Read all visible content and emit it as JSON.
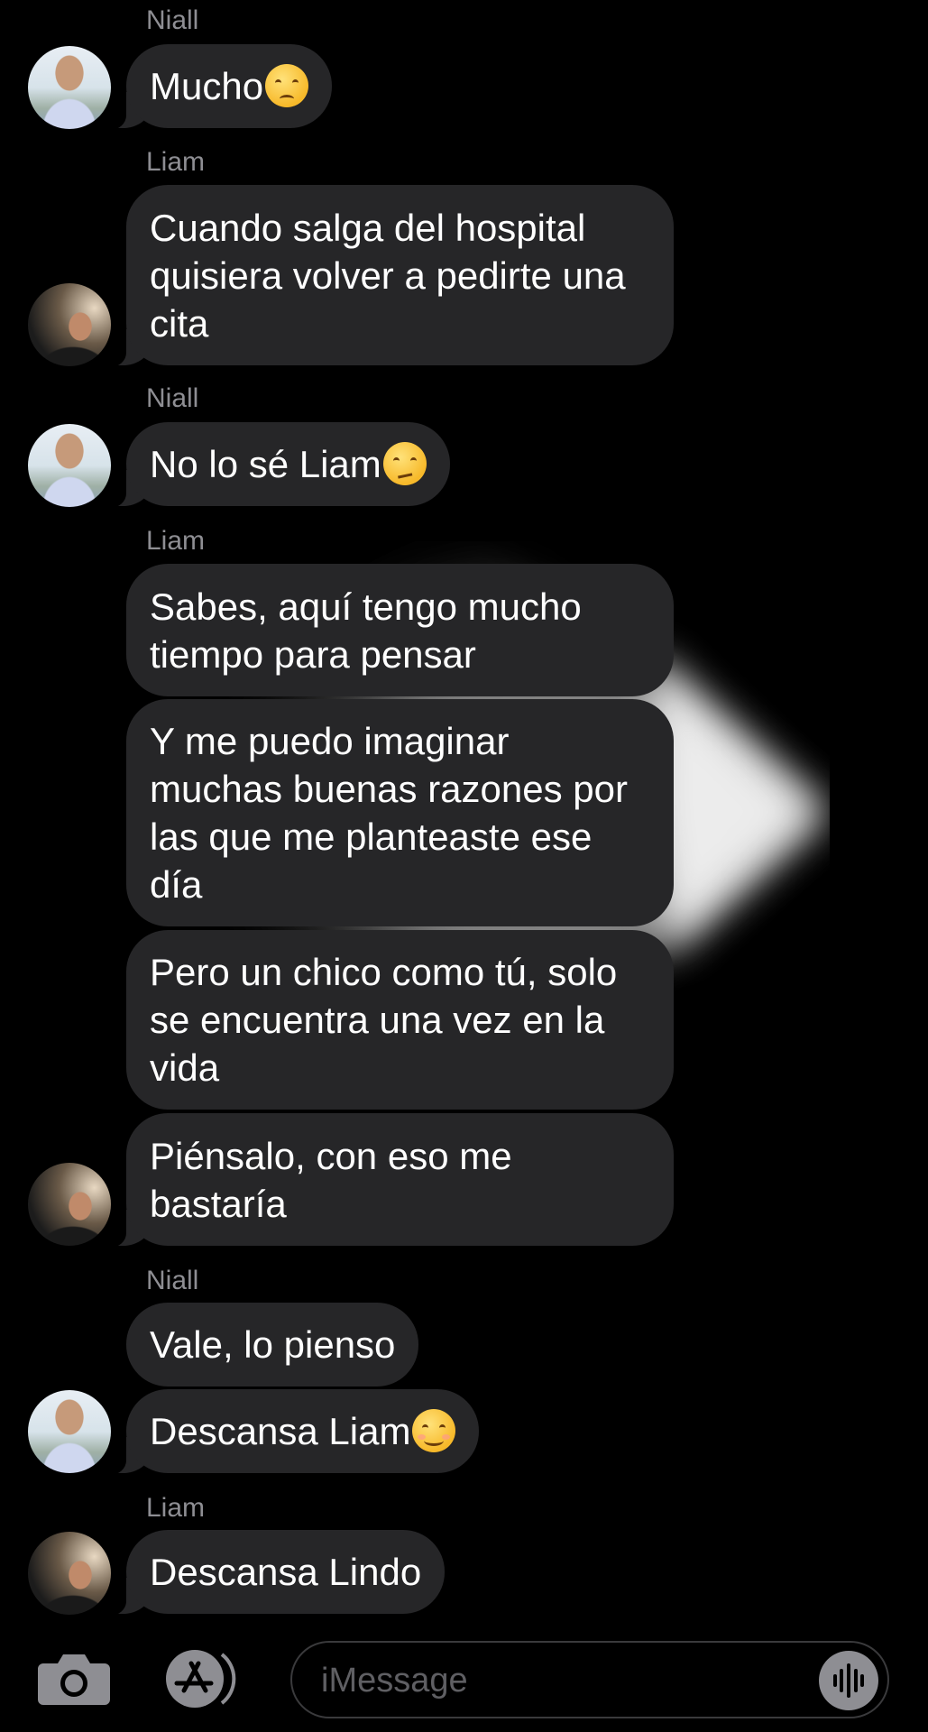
{
  "messages": [
    {
      "sender": "Niall",
      "text": "Mucho",
      "emoji": "pensive-face"
    },
    {
      "sender": "Liam",
      "lines": [
        "Cuando salga del hospital",
        "quisiera volver a pedirte una",
        "cita"
      ]
    },
    {
      "sender": "Niall",
      "text": "No lo sé Liam",
      "emoji": "confused-face"
    },
    {
      "sender": "Liam",
      "lines": [
        "Sabes, aquí tengo mucho",
        "tiempo para pensar"
      ]
    },
    {
      "lines": [
        "Y me puedo imaginar",
        "muchas buenas razones por",
        "las que me planteaste ese",
        "día"
      ]
    },
    {
      "lines": [
        "Pero un chico como tú, solo",
        "se encuentra una vez en la",
        "vida"
      ]
    },
    {
      "lines": [
        "Piénsalo, con eso me",
        "bastaría"
      ]
    },
    {
      "sender": "Niall",
      "text": "Vale, lo pienso"
    },
    {
      "text": "Descansa Liam",
      "emoji": "smiling-face"
    },
    {
      "sender": "Liam",
      "text": "Descansa Lindo"
    }
  ],
  "input": {
    "placeholder": "iMessage"
  },
  "icons": {
    "camera": "camera-icon",
    "appstore": "app-store-icon",
    "audio": "waveform-icon"
  },
  "colors": {
    "background": "#000000",
    "bubble": "#262628",
    "sender": "#8e8e93"
  }
}
